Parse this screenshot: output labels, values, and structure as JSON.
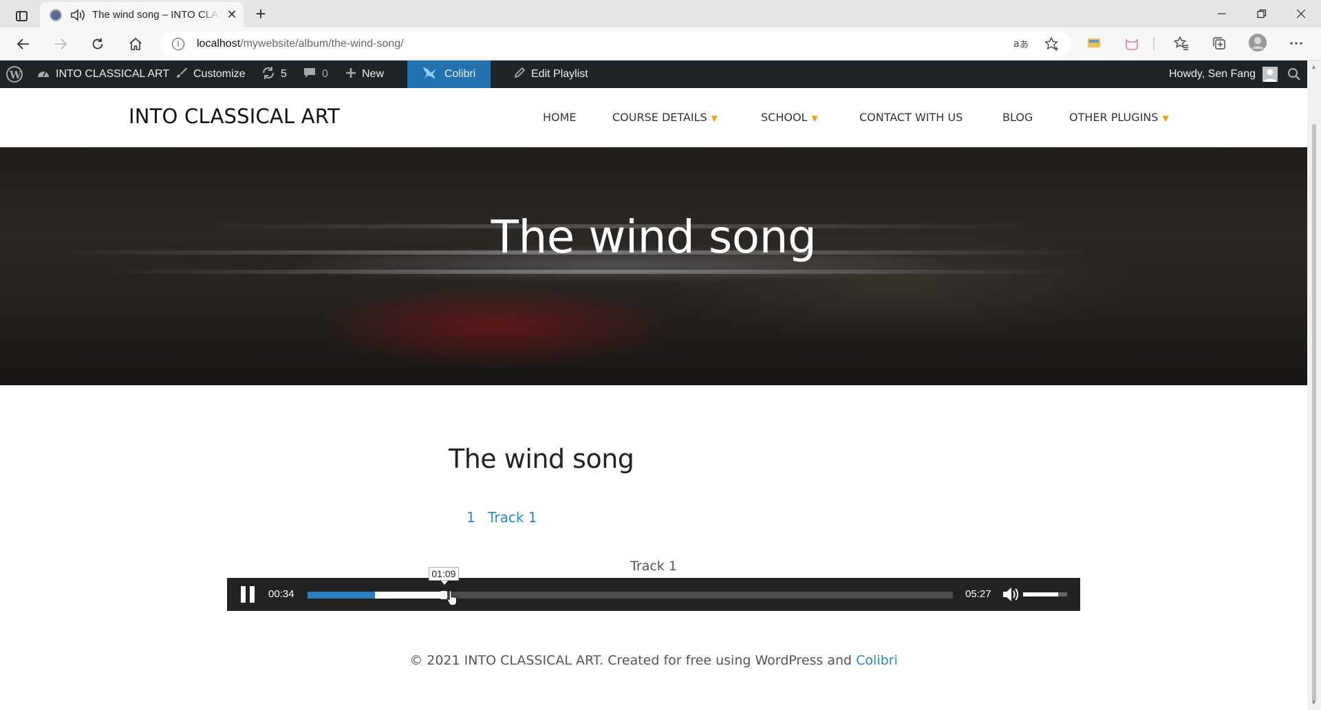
{
  "browser": {
    "tab_title": "The wind song – INTO CLASSICAL ART",
    "tab_close": "✕",
    "new_tab": "+",
    "url_host": "localhost",
    "url_path": "/mywebsite/album/the-wind-song/"
  },
  "adminbar": {
    "site_name": "INTO CLASSICAL ART",
    "customize": "Customize",
    "updates_count": "5",
    "comments_count": "0",
    "new": "New",
    "colibri": "Colibri",
    "edit_playlist": "Edit Playlist",
    "howdy": "Howdy, Sen Fang"
  },
  "header": {
    "site_title": "INTO CLASSICAL ART",
    "menu": [
      {
        "label": "HOME",
        "has_dropdown": false
      },
      {
        "label": "COURSE DETAILS",
        "has_dropdown": true
      },
      {
        "label": "SCHOOL",
        "has_dropdown": true
      },
      {
        "label": "CONTACT WITH US",
        "has_dropdown": false
      },
      {
        "label": "BLOG",
        "has_dropdown": false
      },
      {
        "label": "OTHER PLUGINS",
        "has_dropdown": true
      }
    ]
  },
  "hero": {
    "title": "The wind song"
  },
  "content": {
    "title": "The wind song",
    "tracks": [
      {
        "number": "1",
        "title": "Track 1"
      }
    ],
    "now_playing": "Track 1"
  },
  "player": {
    "current_time": "00:34",
    "duration": "05:27",
    "hover_time": "01:09",
    "played_fraction": 0.104,
    "hover_fraction": 0.211,
    "volume_fraction": 0.8
  },
  "footer": {
    "text": "© 2021 INTO CLASSICAL ART. Created for free using WordPress and",
    "link": "Colibri"
  },
  "colors": {
    "admin_bar": "#1d2327",
    "admin_highlight": "#2271b1",
    "link": "#2f86c6",
    "menu_caret": "#f0a01c",
    "player_bg": "#222222",
    "progress_played": "#2b7fbf"
  }
}
